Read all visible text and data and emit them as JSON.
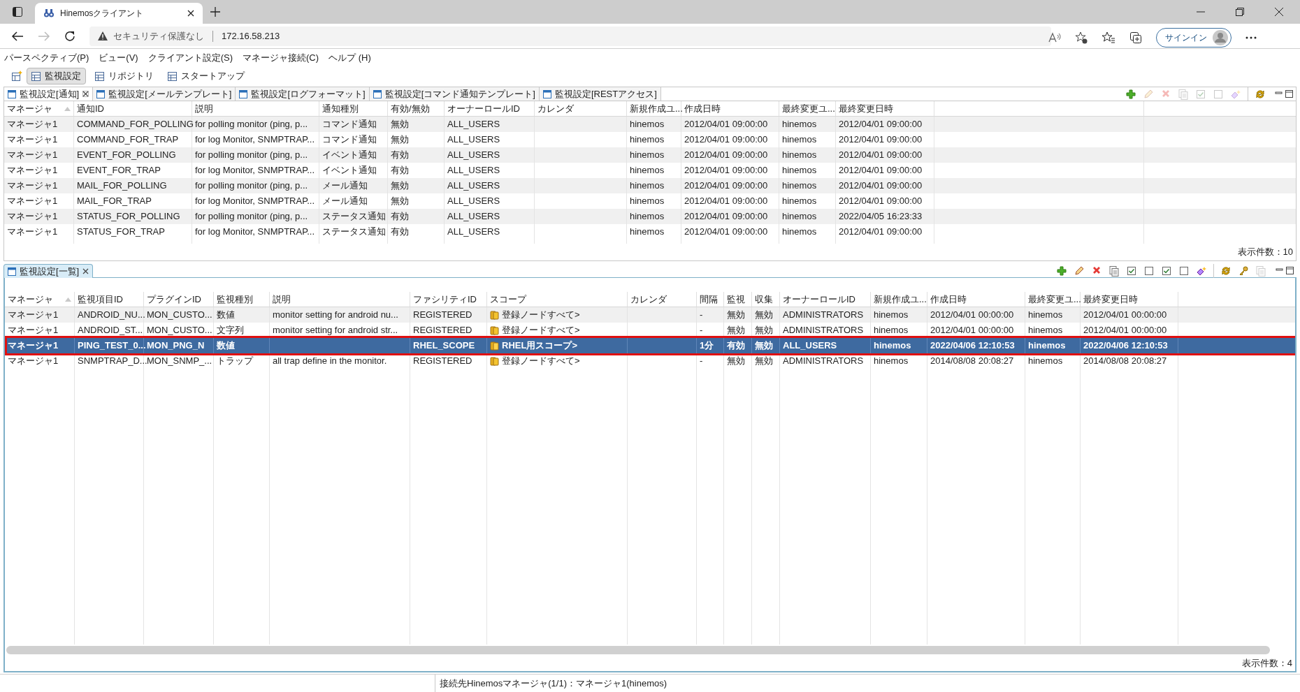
{
  "browser": {
    "tab_title": "Hinemosクライアント",
    "security": "セキュリティ保護なし",
    "url": "172.16.58.213",
    "signin": "サインイン"
  },
  "menu": [
    "パースペクティブ(P)",
    "ビュー(V)",
    "クライアント設定(S)",
    "マネージャ接続(C)",
    "ヘルプ (H)"
  ],
  "perspectives": [
    {
      "label": "監視設定",
      "selected": true
    },
    {
      "label": "リポジトリ",
      "selected": false
    },
    {
      "label": "スタートアップ",
      "selected": false
    }
  ],
  "top_view": {
    "tabs": [
      {
        "label": "監視設定[通知]",
        "selected": true
      },
      {
        "label": "監視設定[メールテンプレート]",
        "selected": false
      },
      {
        "label": "監視設定[ログフォーマット]",
        "selected": false
      },
      {
        "label": "監視設定[コマンド通知テンプレート]",
        "selected": false
      },
      {
        "label": "監視設定[RESTアクセス]",
        "selected": false
      }
    ],
    "toolbar": [
      {
        "kind": "add",
        "disabled": false
      },
      {
        "kind": "edit",
        "disabled": true
      },
      {
        "kind": "delete",
        "disabled": true
      },
      {
        "kind": "copy",
        "disabled": true
      },
      {
        "kind": "check",
        "disabled": true
      },
      {
        "kind": "uncheck",
        "disabled": true
      },
      {
        "kind": "clear",
        "disabled": true
      },
      {
        "kind": "refresh",
        "disabled": false
      }
    ],
    "columns": [
      "マネージャ",
      "通知ID",
      "説明",
      "通知種別",
      "有効/無効",
      "オーナーロールID",
      "カレンダ",
      "新規作成ユ...",
      "作成日時",
      "最終変更ユ...",
      "最終変更日時"
    ],
    "rows": [
      {
        "selected": false,
        "cells": [
          "マネージャ1",
          "COMMAND_FOR_POLLING",
          "for polling monitor (ping, p...",
          "コマンド通知",
          "無効",
          "ALL_USERS",
          "",
          "hinemos",
          "2012/04/01 09:00:00",
          "hinemos",
          "2012/04/01 09:00:00"
        ]
      },
      {
        "selected": false,
        "cells": [
          "マネージャ1",
          "COMMAND_FOR_TRAP",
          "for log Monitor, SNMPTRAP...",
          "コマンド通知",
          "無効",
          "ALL_USERS",
          "",
          "hinemos",
          "2012/04/01 09:00:00",
          "hinemos",
          "2012/04/01 09:00:00"
        ]
      },
      {
        "selected": false,
        "cells": [
          "マネージャ1",
          "EVENT_FOR_POLLING",
          "for polling monitor (ping, p...",
          "イベント通知",
          "有効",
          "ALL_USERS",
          "",
          "hinemos",
          "2012/04/01 09:00:00",
          "hinemos",
          "2012/04/01 09:00:00"
        ]
      },
      {
        "selected": false,
        "cells": [
          "マネージャ1",
          "EVENT_FOR_TRAP",
          "for log Monitor, SNMPTRAP...",
          "イベント通知",
          "有効",
          "ALL_USERS",
          "",
          "hinemos",
          "2012/04/01 09:00:00",
          "hinemos",
          "2012/04/01 09:00:00"
        ]
      },
      {
        "selected": false,
        "cells": [
          "マネージャ1",
          "MAIL_FOR_POLLING",
          "for polling monitor (ping, p...",
          "メール通知",
          "無効",
          "ALL_USERS",
          "",
          "hinemos",
          "2012/04/01 09:00:00",
          "hinemos",
          "2012/04/01 09:00:00"
        ]
      },
      {
        "selected": false,
        "cells": [
          "マネージャ1",
          "MAIL_FOR_TRAP",
          "for log Monitor, SNMPTRAP...",
          "メール通知",
          "無効",
          "ALL_USERS",
          "",
          "hinemos",
          "2012/04/01 09:00:00",
          "hinemos",
          "2012/04/01 09:00:00"
        ]
      },
      {
        "selected": false,
        "cells": [
          "マネージャ1",
          "STATUS_FOR_POLLING",
          "for polling monitor (ping, p...",
          "ステータス通知",
          "有効",
          "ALL_USERS",
          "",
          "hinemos",
          "2012/04/01 09:00:00",
          "hinemos",
          "2022/04/05 16:23:33"
        ]
      },
      {
        "selected": false,
        "cells": [
          "マネージャ1",
          "STATUS_FOR_TRAP",
          "for log Monitor, SNMPTRAP...",
          "ステータス通知",
          "有効",
          "ALL_USERS",
          "",
          "hinemos",
          "2012/04/01 09:00:00",
          "hinemos",
          "2012/04/01 09:00:00"
        ]
      }
    ],
    "footer": "表示件数：10"
  },
  "bottom_view": {
    "tabs": [
      {
        "label": "監視設定[一覧]",
        "selected": true
      }
    ],
    "toolbar": [
      {
        "kind": "add",
        "disabled": false
      },
      {
        "kind": "edit",
        "disabled": false
      },
      {
        "kind": "delete",
        "disabled": false
      },
      {
        "kind": "copy",
        "disabled": false
      },
      {
        "kind": "check",
        "disabled": false
      },
      {
        "kind": "uncheck",
        "disabled": false
      },
      {
        "kind": "check",
        "disabled": false
      },
      {
        "kind": "uncheck",
        "disabled": false
      },
      {
        "kind": "clear",
        "disabled": false
      },
      {
        "kind": "refresh",
        "disabled": false
      },
      {
        "kind": "key",
        "disabled": false
      },
      {
        "kind": "copy",
        "disabled": true
      }
    ],
    "columns": [
      "マネージャ",
      "監視項目ID",
      "プラグインID",
      "監視種別",
      "説明",
      "ファシリティID",
      "スコープ",
      "カレンダ",
      "間隔",
      "監視",
      "収集",
      "オーナーロールID",
      "新規作成ユ...",
      "作成日時",
      "最終変更ユ...",
      "最終変更日時"
    ],
    "rows": [
      {
        "selected": false,
        "cells": [
          "マネージャ1",
          "ANDROID_NU...",
          "MON_CUSTO...",
          "数値",
          "monitor setting for android nu...",
          "REGISTERED",
          "登録ノードすべて>",
          "",
          "-",
          "無効",
          "無効",
          "ADMINISTRATORS",
          "hinemos",
          "2012/04/01 00:00:00",
          "hinemos",
          "2012/04/01 00:00:00"
        ]
      },
      {
        "selected": false,
        "cells": [
          "マネージャ1",
          "ANDROID_ST...",
          "MON_CUSTO...",
          "文字列",
          "monitor setting for android str...",
          "REGISTERED",
          "登録ノードすべて>",
          "",
          "-",
          "無効",
          "無効",
          "ADMINISTRATORS",
          "hinemos",
          "2012/04/01 00:00:00",
          "hinemos",
          "2012/04/01 00:00:00"
        ]
      },
      {
        "selected": true,
        "cells": [
          "マネージャ1",
          "PING_TEST_0...",
          "MON_PNG_N",
          "数値",
          "",
          "RHEL_SCOPE",
          "RHEL用スコープ>",
          "",
          "1分",
          "有効",
          "無効",
          "ALL_USERS",
          "hinemos",
          "2022/04/06 12:10:53",
          "hinemos",
          "2022/04/06 12:10:53"
        ]
      },
      {
        "selected": false,
        "cells": [
          "マネージャ1",
          "SNMPTRAP_D...",
          "MON_SNMP_...",
          "トラップ",
          "all trap define in the monitor.",
          "REGISTERED",
          "登録ノードすべて>",
          "",
          "-",
          "無効",
          "無効",
          "ADMINISTRATORS",
          "hinemos",
          "2014/08/08 20:08:27",
          "hinemos",
          "2014/08/08 20:08:27"
        ]
      }
    ],
    "footer": "表示件数：4"
  },
  "status_bar": "接続先Hinemosマネージャ(1/1)：マネージャ1(hinemos)"
}
